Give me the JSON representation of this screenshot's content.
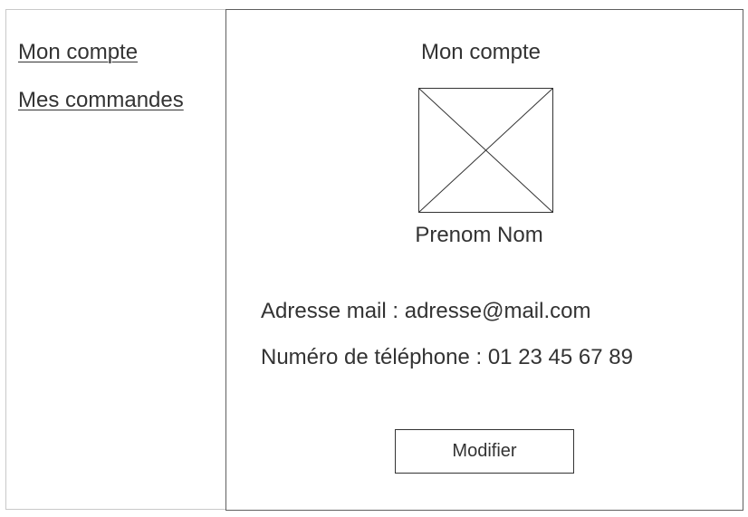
{
  "sidebar": {
    "items": [
      {
        "label": "Mon compte"
      },
      {
        "label": "Mes commandes"
      }
    ]
  },
  "main": {
    "title": "Mon compte",
    "avatar_icon": "image-placeholder-icon",
    "user_name": "Prenom Nom",
    "email_line": "Adresse mail : adresse@mail.com",
    "phone_line": "Numéro de téléphone : 01 23 45 67 89",
    "modify_label": "Modifier"
  },
  "colors": {
    "text": "#333333",
    "panel_border": "#5f5f5f",
    "sidebar_border": "#c9c9c9",
    "background": "#ffffff"
  }
}
